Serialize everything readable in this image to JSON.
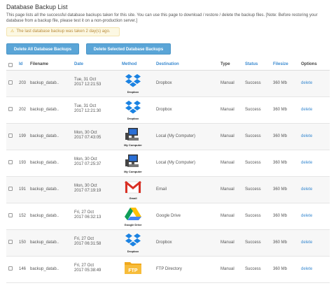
{
  "page": {
    "title": "Database Backup List",
    "description": "This page lists all the successful database backups taken for this site. You can use this page to download / restore / delete the backup files. [Note: Before restoring your database from a backup file, please test it on a non-production server.]",
    "alert": "The last database backup was taken 2 day(s) ago."
  },
  "toolbar": {
    "delete_all": "Delete All Database Backups",
    "delete_selected": "Delete Selected Database Backups"
  },
  "table": {
    "headers": {
      "id": "Id",
      "filename": "Filename",
      "date": "Date",
      "method": "Method",
      "destination": "Destination",
      "type": "Type",
      "status": "Status",
      "filesize": "Filesize",
      "options": "Options"
    },
    "rows": [
      {
        "id": "203",
        "filename": "backup_datab..",
        "date1": "Tue, 31 Oct",
        "date2": "2017 12:21:53",
        "method_icon": "dropbox-icon",
        "method_label": "Dropbox",
        "destination": "Dropbox",
        "type": "Manual",
        "status": "Success",
        "filesize": "360 Mb",
        "option": "delete"
      },
      {
        "id": "202",
        "filename": "backup_datab..",
        "date1": "Tue, 31 Oct",
        "date2": "2017 12:21:30",
        "method_icon": "dropbox-icon",
        "method_label": "Dropbox",
        "destination": "Dropbox",
        "type": "Manual",
        "status": "Success",
        "filesize": "360 Mb",
        "option": "delete"
      },
      {
        "id": "199",
        "filename": "backup_datab..",
        "date1": "Mon, 30 Oct",
        "date2": "2017 07:43:05",
        "method_icon": "computer-icon",
        "method_label": "My Computer",
        "destination": "Local (My Computer)",
        "type": "Manual",
        "status": "Success",
        "filesize": "360 Mb",
        "option": "delete"
      },
      {
        "id": "193",
        "filename": "backup_datab..",
        "date1": "Mon, 30 Oct",
        "date2": "2017 07:25:37",
        "method_icon": "computer-icon",
        "method_label": "My Computer",
        "destination": "Local (My Computer)",
        "type": "Manual",
        "status": "Success",
        "filesize": "360 Mb",
        "option": "delete"
      },
      {
        "id": "191",
        "filename": "backup_datab..",
        "date1": "Mon, 30 Oct",
        "date2": "2017 07:19:19",
        "method_icon": "gmail-icon",
        "method_label": "Gmail",
        "destination": "Email",
        "type": "Manual",
        "status": "Success",
        "filesize": "360 Mb",
        "option": "delete"
      },
      {
        "id": "152",
        "filename": "backup_datab..",
        "date1": "Fri, 27 Oct",
        "date2": "2017 06:32:13",
        "method_icon": "google-drive-icon",
        "method_label": "Google Drive",
        "destination": "Google Drive",
        "type": "Manual",
        "status": "Success",
        "filesize": "360 Mb",
        "option": "delete"
      },
      {
        "id": "150",
        "filename": "backup_datab..",
        "date1": "Fri, 27 Oct",
        "date2": "2017 06:31:58",
        "method_icon": "dropbox-icon",
        "method_label": "Dropbox",
        "destination": "Dropbox",
        "type": "Manual",
        "status": "Success",
        "filesize": "360 Mb",
        "option": "delete"
      },
      {
        "id": "146",
        "filename": "backup_datab..",
        "date1": "Fri, 27 Oct",
        "date2": "2017 05:38:49",
        "method_icon": "ftp-icon",
        "method_label": "FTP",
        "destination": "FTP Directory",
        "type": "Manual",
        "status": "Success",
        "filesize": "360 Mb",
        "option": "delete"
      }
    ]
  },
  "colors": {
    "button": "#5aa5d7",
    "link": "#3a8ad0",
    "alert_bg": "#fcf8e3",
    "alert_text": "#b88a3a"
  }
}
